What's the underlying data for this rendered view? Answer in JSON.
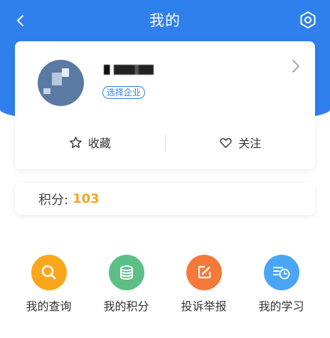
{
  "header": {
    "title": "我的",
    "back_icon": "chevron-left-icon",
    "settings_icon": "hexagon-settings-icon"
  },
  "profile": {
    "select_company": "选择企业",
    "actions": [
      {
        "label": "收藏",
        "icon": "star-icon"
      },
      {
        "label": "关注",
        "icon": "heart-icon"
      }
    ]
  },
  "points": {
    "label": "积分:",
    "value": "103"
  },
  "grid": [
    {
      "label": "我的查询",
      "icon": "search-icon",
      "color": "#fba71b"
    },
    {
      "label": "我的积分",
      "icon": "coin-stack-icon",
      "color": "#5cbf86"
    },
    {
      "label": "投诉举报",
      "icon": "edit-icon",
      "color": "#f57a3a"
    },
    {
      "label": "我的学习",
      "icon": "study-clock-icon",
      "color": "#4aa6f5"
    }
  ],
  "colors": {
    "primary": "#2f80ed",
    "points_accent": "#f5a623"
  }
}
